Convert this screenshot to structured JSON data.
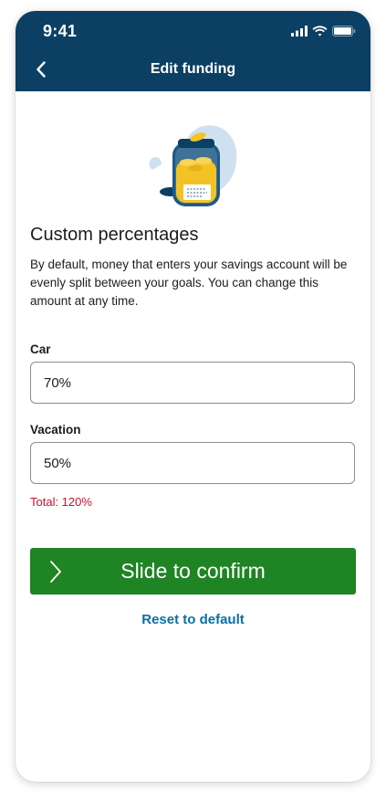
{
  "status_bar": {
    "time": "9:41"
  },
  "nav": {
    "title": "Edit funding",
    "back_icon": "chevron-left-icon"
  },
  "illustration": {
    "icon": "savings-jar-icon"
  },
  "section": {
    "title": "Custom percentages",
    "description": "By default, money that enters your savings account will be evenly split between your goals. You can change this amount at any time."
  },
  "fields": [
    {
      "label": "Car",
      "value": "70%"
    },
    {
      "label": "Vacation",
      "value": "50%"
    }
  ],
  "error": {
    "text": "Total: 120%"
  },
  "actions": {
    "slide_label": "Slide to confirm",
    "reset_label": "Reset to default"
  },
  "colors": {
    "header_bg": "#0b3f63",
    "confirm_bg": "#1f8423",
    "link": "#0b6fa4",
    "error": "#c8102e"
  }
}
